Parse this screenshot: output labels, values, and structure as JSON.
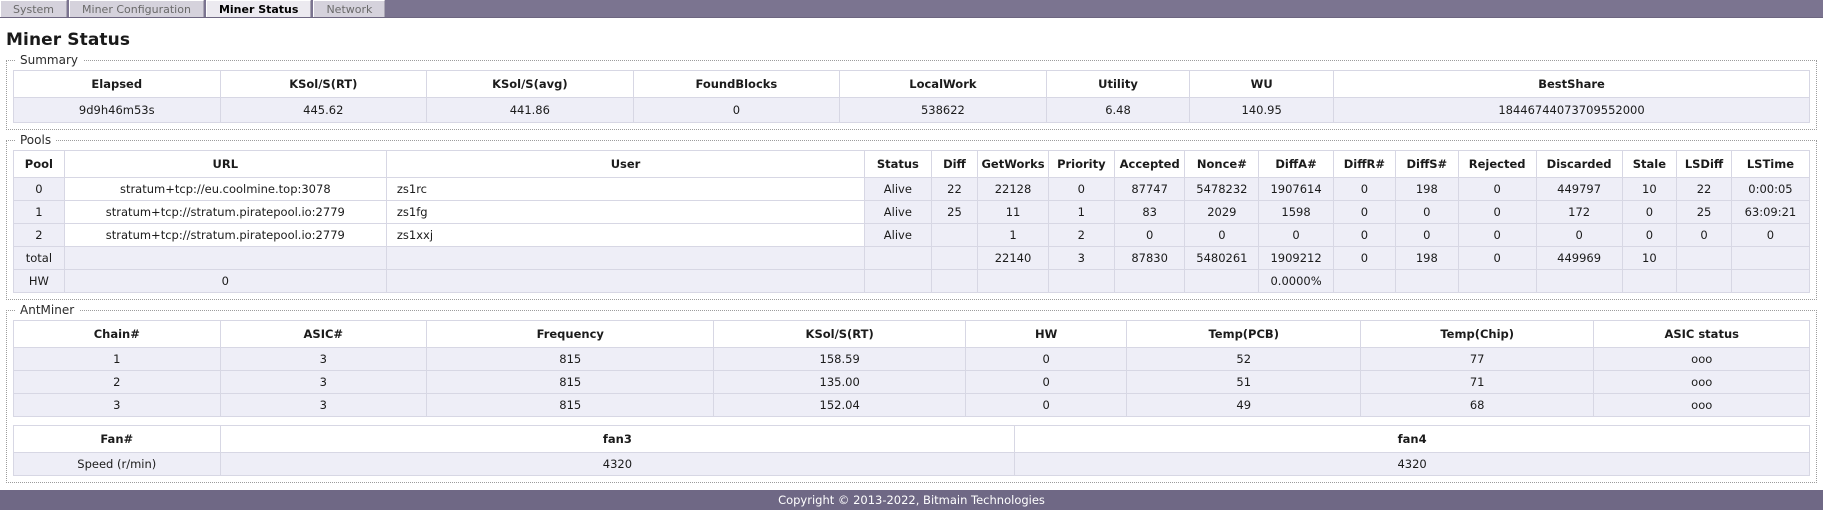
{
  "nav": {
    "tabs": [
      {
        "label": "System",
        "active": false
      },
      {
        "label": "Miner Configuration",
        "active": false
      },
      {
        "label": "Miner Status",
        "active": true
      },
      {
        "label": "Network",
        "active": false
      }
    ]
  },
  "page": {
    "title": "Miner Status"
  },
  "summary": {
    "legend": "Summary",
    "columns": [
      "Elapsed",
      "KSol/S(RT)",
      "KSol/S(avg)",
      "FoundBlocks",
      "LocalWork",
      "Utility",
      "WU",
      "BestShare"
    ],
    "row": [
      "9d9h46m53s",
      "445.62",
      "441.86",
      "0",
      "538622",
      "6.48",
      "140.95",
      "18446744073709552000"
    ]
  },
  "pools": {
    "legend": "Pools",
    "columns": [
      "Pool",
      "URL",
      "User",
      "Status",
      "Diff",
      "GetWorks",
      "Priority",
      "Accepted",
      "Nonce#",
      "DiffA#",
      "DiffR#",
      "DiffS#",
      "Rejected",
      "Discarded",
      "Stale",
      "LSDiff",
      "LSTime"
    ],
    "rows": [
      [
        "0",
        "stratum+tcp://eu.coolmine.top:3078",
        "zs1rc",
        "Alive",
        "22",
        "22128",
        "0",
        "87747",
        "5478232",
        "1907614",
        "0",
        "198",
        "0",
        "449797",
        "10",
        "22",
        "0:00:05"
      ],
      [
        "1",
        "stratum+tcp://stratum.piratepool.io:2779",
        "zs1fg",
        "Alive",
        "25",
        "11",
        "1",
        "83",
        "2029",
        "1598",
        "0",
        "0",
        "0",
        "172",
        "0",
        "25",
        "63:09:21"
      ],
      [
        "2",
        "stratum+tcp://stratum.piratepool.io:2779",
        "zs1xxj",
        "Alive",
        "",
        "1",
        "2",
        "0",
        "0",
        "0",
        "0",
        "0",
        "0",
        "0",
        "0",
        "0",
        "0"
      ]
    ],
    "total_row": [
      "total",
      "",
      "",
      "",
      "",
      "22140",
      "3",
      "87830",
      "5480261",
      "1909212",
      "0",
      "198",
      "0",
      "449969",
      "10",
      "",
      ""
    ],
    "hw_row": [
      "HW",
      "0",
      "",
      "",
      "",
      "",
      "",
      "",
      "",
      "0.0000%",
      "",
      "",
      "",
      "",
      "",
      "",
      ""
    ]
  },
  "antminer": {
    "legend": "AntMiner",
    "columns": [
      "Chain#",
      "ASIC#",
      "Frequency",
      "KSol/S(RT)",
      "HW",
      "Temp(PCB)",
      "Temp(Chip)",
      "ASIC status"
    ],
    "rows": [
      [
        "1",
        "3",
        "815",
        "158.59",
        "0",
        "52",
        "77",
        "ooo"
      ],
      [
        "2",
        "3",
        "815",
        "135.00",
        "0",
        "51",
        "71",
        "ooo"
      ],
      [
        "3",
        "3",
        "815",
        "152.04",
        "0",
        "49",
        "68",
        "ooo"
      ]
    ],
    "fan_columns": [
      "Fan#",
      "fan3",
      "fan4"
    ],
    "fan_row": [
      "Speed (r/min)",
      "4320",
      "4320"
    ]
  },
  "footer": {
    "text": "Copyright © 2013-2022, Bitmain Technologies"
  },
  "colors": {
    "chrome": "#7b7490",
    "footer": "#6f6885",
    "row_alt": "#eeeef7",
    "border": "#d7d7e4"
  }
}
